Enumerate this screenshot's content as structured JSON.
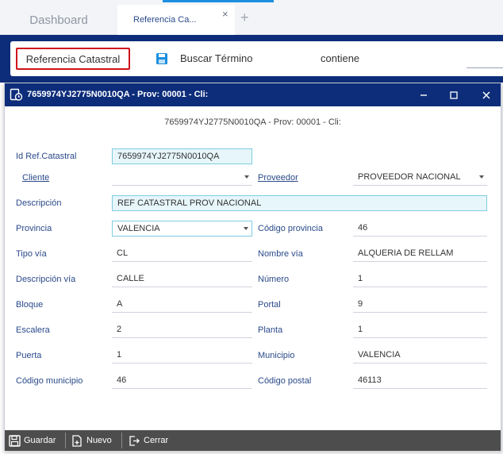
{
  "tabs": {
    "dashboard": "Dashboard",
    "referencia": "Referencia Ca...",
    "close": "×",
    "add": "+"
  },
  "search": {
    "ref_button": "Referencia Catastral",
    "buscar": "Buscar Término",
    "contiene": "contiene"
  },
  "modal": {
    "title": "7659974YJ2775N0010QA - Prov: 00001 - Cli:",
    "subtitle": "7659974YJ2775N0010QA - Prov: 00001 - Cli:",
    "min": "–",
    "max": "□",
    "close": "×"
  },
  "form": {
    "id_ref_label": "Id Ref.Catastral",
    "id_ref_value": "7659974YJ2775N0010QA",
    "cliente_label": "Cliente",
    "cliente_value": "",
    "proveedor_label": "Proveedor",
    "proveedor_value": "PROVEEDOR NACIONAL",
    "descripcion_label": "Descripción",
    "descripcion_value": "REF CATASTRAL PROV NACIONAL",
    "provincia_label": "Provincia",
    "provincia_value": "VALENCIA",
    "cod_provincia_label": "Código provincia",
    "cod_provincia_value": "46",
    "tipo_via_label": "Tipo vía",
    "tipo_via_value": "CL",
    "nombre_via_label": "Nombre vía",
    "nombre_via_value": "ALQUERIA DE RELLAM",
    "desc_via_label": "Descripción vía",
    "desc_via_value": "CALLE",
    "numero_label": "Número",
    "numero_value": "1",
    "bloque_label": "Bloque",
    "bloque_value": "A",
    "portal_label": "Portal",
    "portal_value": "9",
    "escalera_label": "Escalera",
    "escalera_value": "2",
    "planta_label": "Planta",
    "planta_value": "1",
    "puerta_label": "Puerta",
    "puerta_value": "1",
    "municipio_label": "Municipio",
    "municipio_value": "VALENCIA",
    "cod_municipio_label": "Código municipio",
    "cod_municipio_value": "46",
    "cod_postal_label": "Código postal",
    "cod_postal_value": "46113"
  },
  "footer": {
    "guardar": "Guardar",
    "nuevo": "Nuevo",
    "cerrar": "Cerrar"
  },
  "colors": {
    "navy": "#0d2d7a",
    "accent": "#1d8fe0",
    "highlight_border": "#d0121b",
    "field_highlight": "#e6f6fb",
    "footer_bg": "#4d4d4d"
  }
}
